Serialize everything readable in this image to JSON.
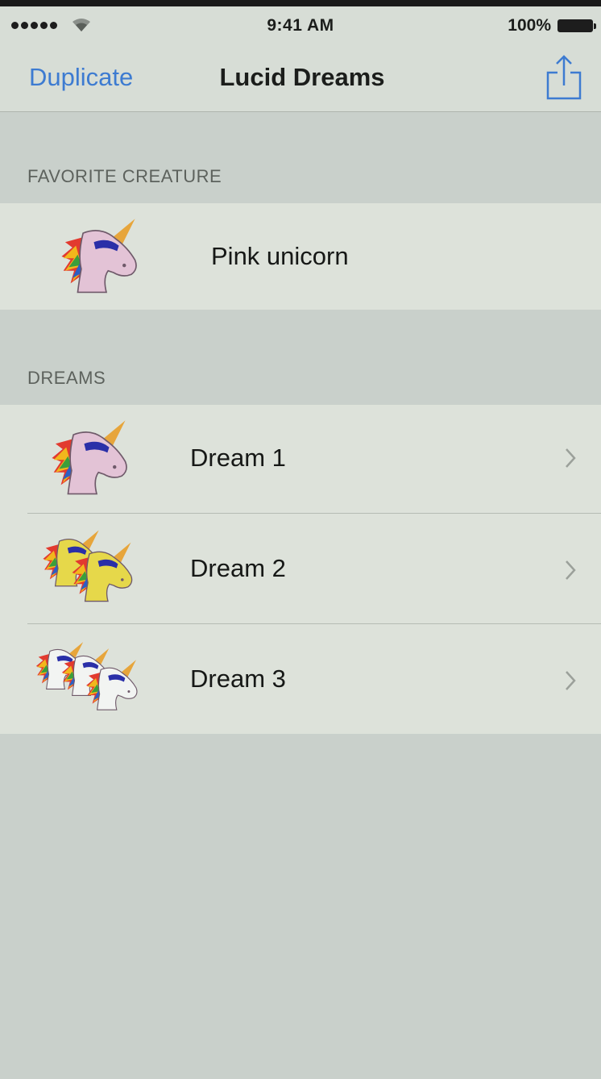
{
  "status_bar": {
    "time": "9:41 AM",
    "battery": "100%",
    "signal_icon": "signal-dots-icon",
    "wifi_icon": "wifi-icon"
  },
  "nav": {
    "left_button": "Duplicate",
    "title": "Lucid Dreams",
    "right_icon": "share-icon"
  },
  "favorite": {
    "header": "FAVORITE CREATURE",
    "name": "Pink unicorn",
    "icon": "pink-unicorn-icon"
  },
  "dreams": {
    "header": "DREAMS",
    "items": [
      {
        "label": "Dream 1",
        "icon": "pink-unicorn-icon"
      },
      {
        "label": "Dream 2",
        "icon": "yellow-unicorns-icon"
      },
      {
        "label": "Dream 3",
        "icon": "white-unicorns-icon"
      }
    ]
  },
  "colors": {
    "accent": "#3d7bd1",
    "background": "#c9d0cb",
    "cell": "#dde2da"
  }
}
